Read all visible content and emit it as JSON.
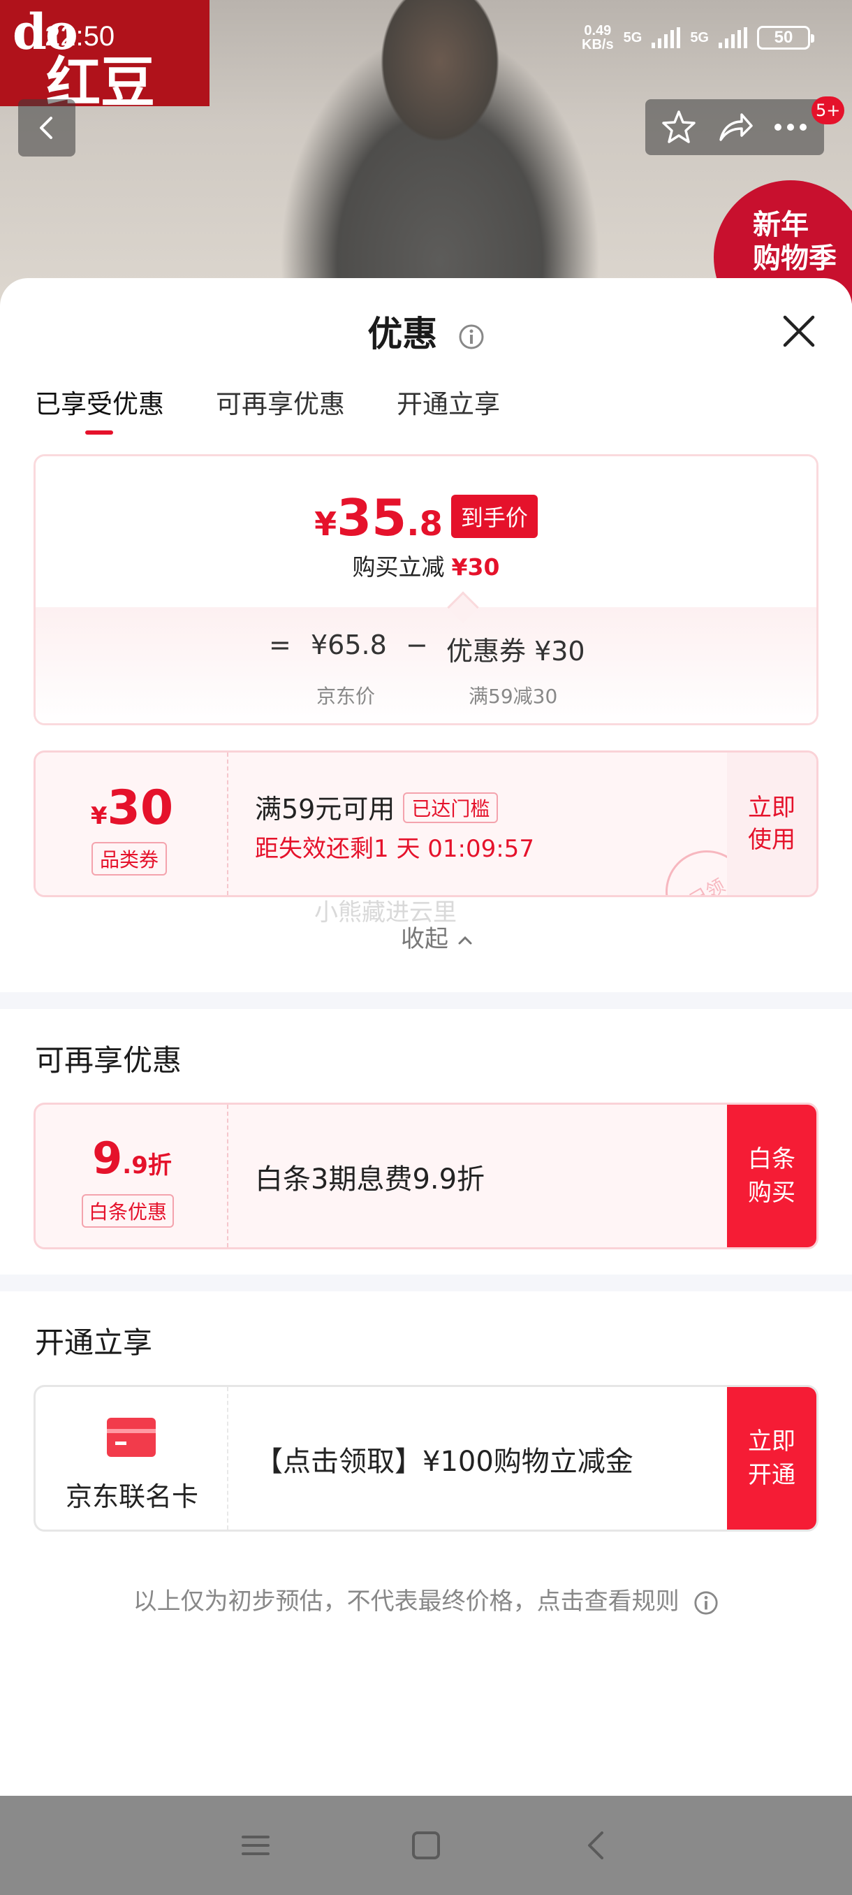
{
  "status_bar": {
    "time": "22:50",
    "net_speed_value": "0.49",
    "net_speed_unit": "KB/s",
    "sim1": "5G",
    "sim2": "5G",
    "battery": "50"
  },
  "background": {
    "brand_en": "do",
    "brand_cn": "红豆",
    "badge_count": "5+",
    "promo_line1": "新年",
    "promo_line2": "购物季"
  },
  "sheet": {
    "title": "优惠",
    "tabs": [
      {
        "label": "已享受优惠",
        "active": true
      },
      {
        "label": "可再享优惠",
        "active": false
      },
      {
        "label": "开通立享",
        "active": false
      }
    ],
    "price_box": {
      "currency": "¥",
      "price_int": "35",
      "price_dec": ".8",
      "final_tag": "到手价",
      "instant_cut_label": "购买立减",
      "instant_cut_value": "¥30",
      "equals": "=",
      "jd_price": "¥65.8",
      "minus": "−",
      "coupon_label": "优惠券 ¥30",
      "jd_price_label": "京东价",
      "coupon_rule": "满59减30"
    },
    "coupon": {
      "currency": "¥",
      "amount": "30",
      "type": "品类券",
      "title": "满59元可用",
      "reached": "已达门槛",
      "timer": "距失效还剩1 天 01:09:57",
      "action_line1": "立即",
      "action_line2": "使用",
      "stamp": "已领"
    },
    "watermark": "小熊藏进云里",
    "collapse": "收起"
  },
  "more_offers": {
    "title": "可再享优惠",
    "discount_int": "9",
    "discount_dec": ".9折",
    "discount_type": "白条优惠",
    "text": "白条3期息费9.9折",
    "action_line1": "白条",
    "action_line2": "购买"
  },
  "activate": {
    "title": "开通立享",
    "card_name": "京东联名卡",
    "text": "【点击领取】¥100购物立减金",
    "action_line1": "立即",
    "action_line2": "开通"
  },
  "footnote": "以上仅为初步预估，不代表最终价格，点击查看规则",
  "colors": {
    "accent": "#e5122b",
    "light_pink": "#fff5f6",
    "border_pink": "#fad2d7"
  }
}
